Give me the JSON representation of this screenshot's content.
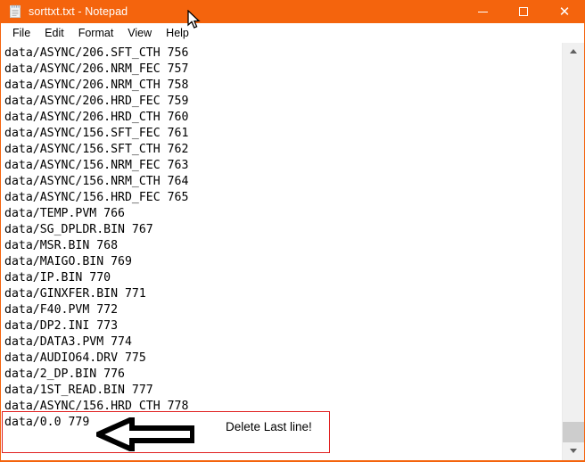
{
  "window": {
    "title": "sorttxt.txt - Notepad",
    "icon": "notepad-icon",
    "titlebar_color": "#f4640d",
    "controls": {
      "minimize": "—",
      "maximize": "□",
      "close": "✕"
    }
  },
  "menubar": {
    "items": [
      {
        "label": "File"
      },
      {
        "label": "Edit"
      },
      {
        "label": "Format"
      },
      {
        "label": "View"
      },
      {
        "label": "Help"
      }
    ]
  },
  "editor": {
    "lines": [
      "data/ASYNC/206.SFT_CTH 756",
      "data/ASYNC/206.NRM_FEC 757",
      "data/ASYNC/206.NRM_CTH 758",
      "data/ASYNC/206.HRD_FEC 759",
      "data/ASYNC/206.HRD_CTH 760",
      "data/ASYNC/156.SFT_FEC 761",
      "data/ASYNC/156.SFT_CTH 762",
      "data/ASYNC/156.NRM_FEC 763",
      "data/ASYNC/156.NRM_CTH 764",
      "data/ASYNC/156.HRD_FEC 765",
      "data/TEMP.PVM 766",
      "data/SG_DPLDR.BIN 767",
      "data/MSR.BIN 768",
      "data/MAIGO.BIN 769",
      "data/IP.BIN 770",
      "data/GINXFER.BIN 771",
      "data/F40.PVM 772",
      "data/DP2.INI 773",
      "data/DATA3.PVM 774",
      "data/AUDIO64.DRV 775",
      "data/2_DP.BIN 776",
      "data/1ST_READ.BIN 777",
      "data/ASYNC/156.HRD_CTH 778",
      "data/0.0 779"
    ]
  },
  "scrollbar": {
    "up_arrow": "scroll-up-arrow",
    "down_arrow": "scroll-down-arrow",
    "thumb": "scroll-thumb"
  },
  "annotation": {
    "label": "Delete Last line!",
    "rect_color": "#e02020",
    "arrow_color": "#000000",
    "arrow_direction": "left"
  },
  "cursor": {
    "type": "arrow-pointer"
  }
}
